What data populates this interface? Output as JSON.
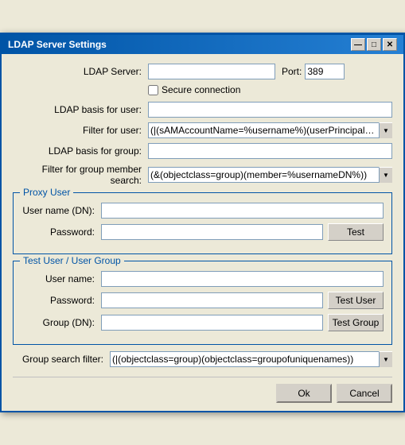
{
  "window": {
    "title": "LDAP Server Settings",
    "close_btn": "✕",
    "minimize_btn": "—",
    "maximize_btn": "□"
  },
  "form": {
    "ldap_server_label": "LDAP Server:",
    "ldap_server_value": "",
    "port_label": "Port:",
    "port_value": "389",
    "secure_label": "Secure connection",
    "ldap_basis_user_label": "LDAP basis for user:",
    "ldap_basis_user_value": "",
    "filter_user_label": "Filter for user:",
    "filter_user_value": "(|(sAMAccountName=%username%)(userPrincipalName=%",
    "ldap_basis_group_label": "LDAP basis for group:",
    "ldap_basis_group_value": "",
    "filter_group_label": "Filter for group member search:",
    "filter_group_value": "(&(objectclass=group)(member=%usernameDN%))"
  },
  "proxy_user": {
    "title": "Proxy User",
    "username_label": "User name (DN):",
    "username_value": "",
    "password_label": "Password:",
    "password_value": "",
    "test_btn": "Test"
  },
  "test_user": {
    "title": "Test User / User Group",
    "username_label": "User name:",
    "username_value": "",
    "password_label": "Password:",
    "password_value": "",
    "test_user_btn": "Test User",
    "group_label": "Group (DN):",
    "group_value": "",
    "test_group_btn": "Test Group"
  },
  "group_search": {
    "label": "Group search filter:",
    "value": "(|(objectclass=group)(objectclass=groupofuniquenames))"
  },
  "buttons": {
    "ok": "Ok",
    "cancel": "Cancel"
  }
}
